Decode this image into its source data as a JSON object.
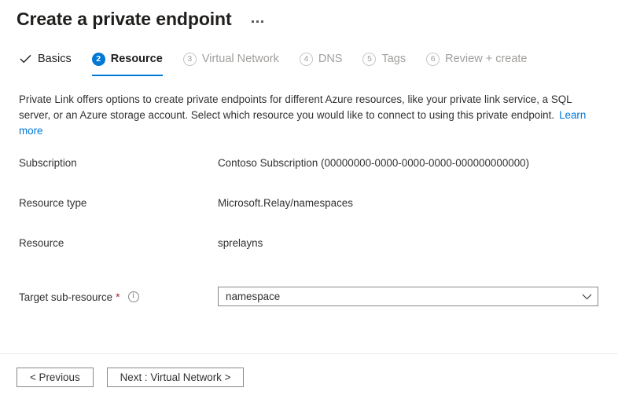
{
  "header": {
    "title": "Create a private endpoint",
    "more_menu": "ellipsis"
  },
  "tabs": [
    {
      "label": "Basics",
      "marker": "check",
      "state": "done"
    },
    {
      "label": "Resource",
      "marker": "2",
      "state": "active"
    },
    {
      "label": "Virtual Network",
      "marker": "3",
      "state": "upcoming"
    },
    {
      "label": "DNS",
      "marker": "4",
      "state": "upcoming"
    },
    {
      "label": "Tags",
      "marker": "5",
      "state": "upcoming"
    },
    {
      "label": "Review + create",
      "marker": "6",
      "state": "upcoming"
    }
  ],
  "description": {
    "text": "Private Link offers options to create private endpoints for different Azure resources, like your private link service, a SQL server, or an Azure storage account. Select which resource you would like to connect to using this private endpoint.",
    "link_label": "Learn more"
  },
  "form": {
    "subscription": {
      "label": "Subscription",
      "value": "Contoso Subscription (00000000-0000-0000-0000-000000000000)"
    },
    "resource_type": {
      "label": "Resource type",
      "value": "Microsoft.Relay/namespaces"
    },
    "resource": {
      "label": "Resource",
      "value": "sprelayns"
    },
    "target_sub_resource": {
      "label": "Target sub-resource",
      "required_mark": "*",
      "info_glyph": "i",
      "value": "namespace"
    }
  },
  "footer": {
    "previous_label": "< Previous",
    "next_label": "Next : Virtual Network >"
  },
  "colors": {
    "accent": "#0078d4",
    "required": "#a4262c",
    "text": "#323130",
    "muted": "#a19f9d"
  }
}
